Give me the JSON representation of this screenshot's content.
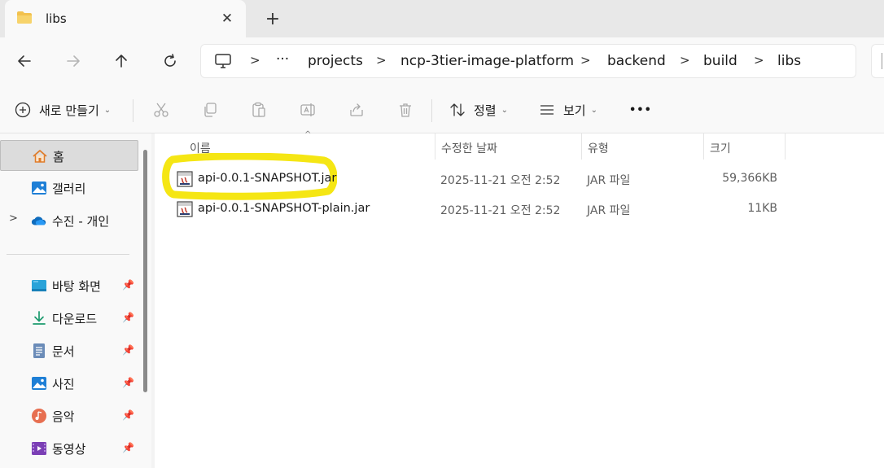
{
  "window": {
    "tab": {
      "title": "libs",
      "close_glyph": "✕"
    },
    "new_tab_glyph": "+"
  },
  "nav": {
    "back_icon": "arrow-left-icon",
    "forward_icon": "arrow-right-icon",
    "up_icon": "arrow-up-icon",
    "refresh_icon": "refresh-icon"
  },
  "breadcrumb": {
    "overflow": "···",
    "separator": ">",
    "items": [
      "projects",
      "ncp-3tier-image-platform",
      "backend",
      "build",
      "libs"
    ]
  },
  "commandbar": {
    "new_label": "새로 만들기",
    "sort_label": "정렬",
    "view_label": "보기",
    "more_glyph": "•••",
    "dropdown_glyph": "⌄"
  },
  "sidebar": {
    "pin_glyph": "📌",
    "expand_glyph": ">",
    "items": [
      {
        "label": "홈",
        "icon": "home-icon",
        "pinned": false,
        "active": true
      },
      {
        "label": "갤러리",
        "icon": "gallery-icon",
        "pinned": false
      },
      {
        "label": "수진 - 개인",
        "icon": "onedrive-cloud-icon",
        "pinned": false,
        "expandable": true
      },
      {
        "label": "바탕 화면",
        "icon": "desktop-icon",
        "pinned": true
      },
      {
        "label": "다운로드",
        "icon": "download-icon",
        "pinned": true
      },
      {
        "label": "문서",
        "icon": "documents-icon",
        "pinned": true
      },
      {
        "label": "사진",
        "icon": "pictures-icon",
        "pinned": true
      },
      {
        "label": "음악",
        "icon": "music-icon",
        "pinned": true
      },
      {
        "label": "동영상",
        "icon": "videos-icon",
        "pinned": true
      }
    ]
  },
  "columns": {
    "name": "이름",
    "modified": "수정한 날짜",
    "type": "유형",
    "size": "크기",
    "sort_glyph": "^"
  },
  "files": [
    {
      "name": "api-0.0.1-SNAPSHOT.jar",
      "modified": "2025-11-21 오전 2:52",
      "type": "JAR 파일",
      "size": "59,366KB",
      "highlighted": true
    },
    {
      "name": "api-0.0.1-SNAPSHOT-plain.jar",
      "modified": "2025-11-21 오전 2:52",
      "type": "JAR 파일",
      "size": "11KB",
      "highlighted": false
    }
  ],
  "colors": {
    "highlight": "#f5e614",
    "folder": "#f2c14e",
    "accent": "#0067c0"
  }
}
